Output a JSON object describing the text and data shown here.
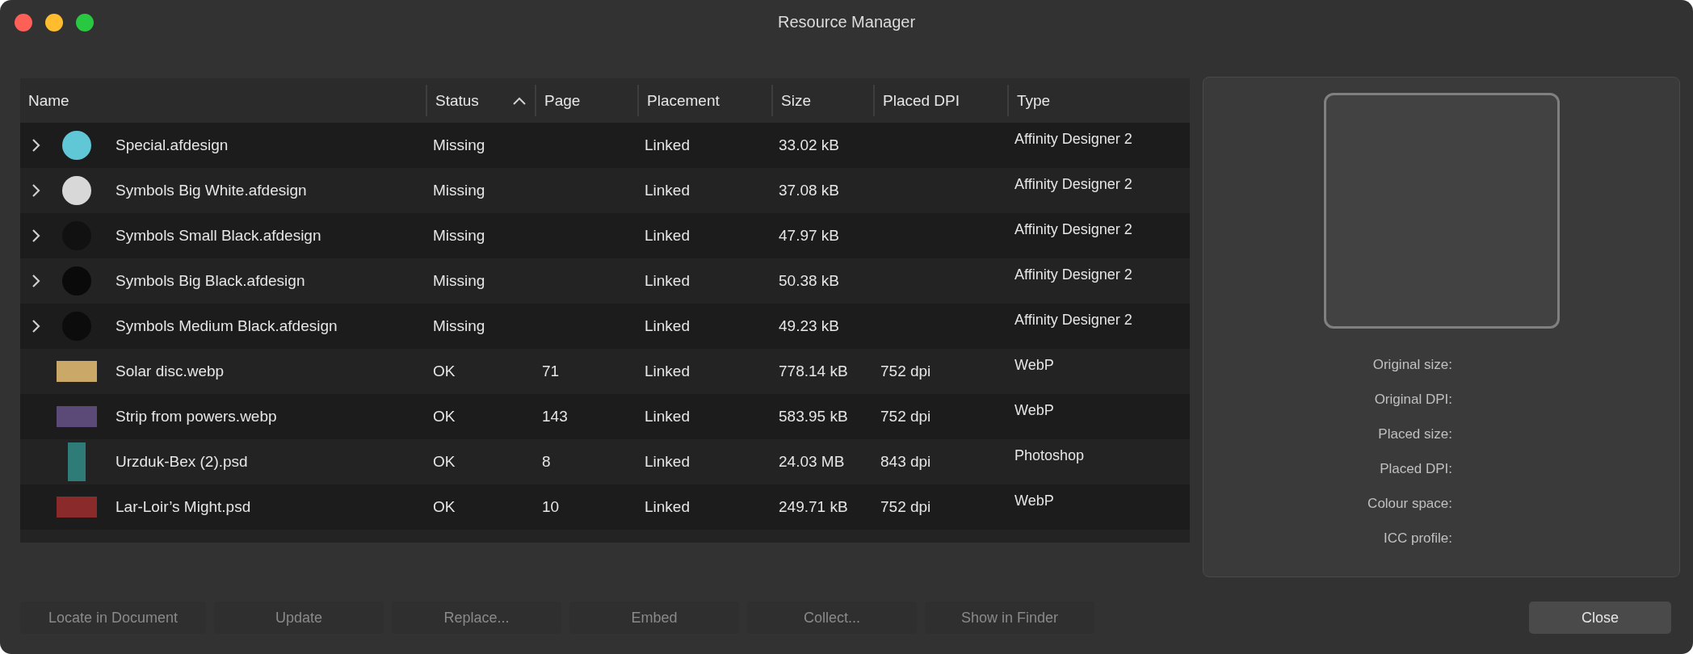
{
  "window": {
    "title": "Resource Manager"
  },
  "table": {
    "columns": [
      {
        "label": "Name",
        "sorted": false
      },
      {
        "label": "Status",
        "sorted": true
      },
      {
        "label": "Page",
        "sorted": false
      },
      {
        "label": "Placement",
        "sorted": false
      },
      {
        "label": "Size",
        "sorted": false
      },
      {
        "label": "Placed DPI",
        "sorted": false
      },
      {
        "label": "Type",
        "sorted": false
      }
    ],
    "rows": [
      {
        "name": "Special.afdesign",
        "kind": "group",
        "expanded": false,
        "status": "Missing",
        "page": "",
        "placement": "Linked",
        "size": "33.02 kB",
        "placed_dpi": "",
        "type": "Affinity Designer 2"
      },
      {
        "name": "Symbols Big White.afdesign",
        "kind": "group",
        "expanded": false,
        "status": "Missing",
        "page": "",
        "placement": "Linked",
        "size": "37.08 kB",
        "placed_dpi": "",
        "type": "Affinity Designer 2"
      },
      {
        "name": "Symbols Small Black.afdesign",
        "kind": "group",
        "expanded": false,
        "status": "Missing",
        "page": "",
        "placement": "Linked",
        "size": "47.97 kB",
        "placed_dpi": "",
        "type": "Affinity Designer 2"
      },
      {
        "name": "Symbols Big Black.afdesign",
        "kind": "group",
        "expanded": false,
        "status": "Missing",
        "page": "",
        "placement": "Linked",
        "size": "50.38 kB",
        "placed_dpi": "",
        "type": "Affinity Designer 2"
      },
      {
        "name": "Symbols Medium Black.afdesign",
        "kind": "group",
        "expanded": false,
        "status": "Missing",
        "page": "",
        "placement": "Linked",
        "size": "49.23 kB",
        "placed_dpi": "",
        "type": "Affinity Designer 2"
      },
      {
        "name": "Solar disc.webp",
        "kind": "image",
        "status": "OK",
        "page": "71",
        "placement": "Linked",
        "size": "778.14 kB",
        "placed_dpi": "752 dpi",
        "type": "WebP"
      },
      {
        "name": "Strip from powers.webp",
        "kind": "image",
        "status": "OK",
        "page": "143",
        "placement": "Linked",
        "size": "583.95 kB",
        "placed_dpi": "752 dpi",
        "type": "WebP"
      },
      {
        "name": "Urzduk-Bex (2).psd",
        "kind": "image",
        "status": "OK",
        "page": "8",
        "placement": "Linked",
        "size": "24.03 MB",
        "placed_dpi": "843 dpi",
        "type": "Photoshop"
      },
      {
        "name": "Lar-Loir’s Might.psd",
        "kind": "image",
        "status": "OK",
        "page": "10",
        "placement": "Linked",
        "size": "249.71 kB",
        "placed_dpi": "752 dpi",
        "type": "WebP"
      }
    ]
  },
  "info_panel": {
    "fields": [
      {
        "label": "Original size:"
      },
      {
        "label": "Original DPI:"
      },
      {
        "label": "Placed size:"
      },
      {
        "label": "Placed DPI:"
      },
      {
        "label": "Colour space:"
      },
      {
        "label": "ICC profile:"
      }
    ]
  },
  "buttons": [
    {
      "label": "Locate in Document",
      "disabled": true
    },
    {
      "label": "Update",
      "disabled": true
    },
    {
      "label": "Replace...",
      "disabled": true
    },
    {
      "label": "Embed",
      "disabled": true
    },
    {
      "label": "Collect...",
      "disabled": true
    },
    {
      "label": "Show in Finder",
      "disabled": true
    }
  ],
  "close_button": {
    "label": "Close",
    "disabled": false
  }
}
